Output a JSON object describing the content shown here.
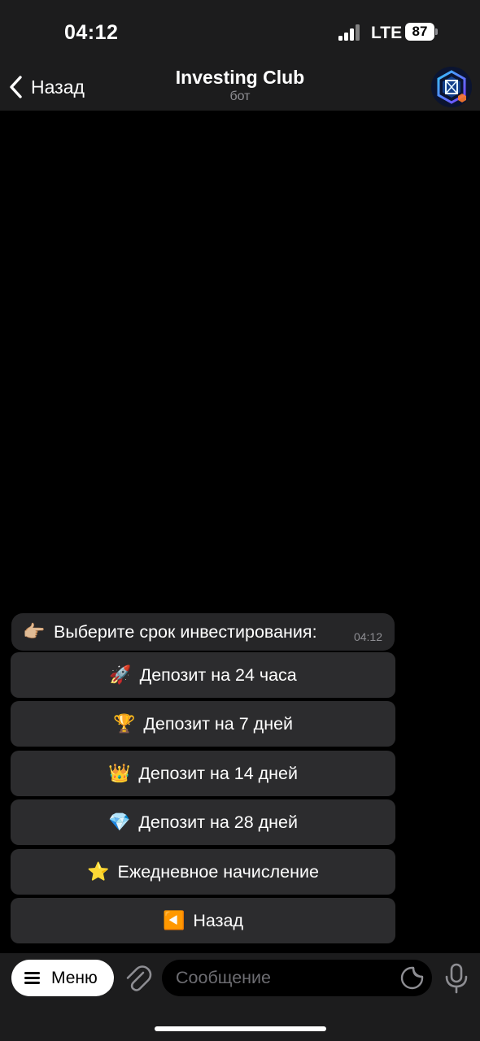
{
  "status": {
    "time": "04:12",
    "network": "LTE",
    "battery": "87"
  },
  "header": {
    "back_label": "Назад",
    "title": "Investing Club",
    "subtitle": "бот"
  },
  "message": {
    "emoji": "👉🏼",
    "text": "Выберите срок инвестирования:",
    "time": "04:12"
  },
  "keyboard": [
    {
      "emoji": "🚀",
      "label": "Депозит на 24 часа"
    },
    {
      "emoji": "🏆",
      "label": "Депозит на 7 дней"
    },
    {
      "emoji": "👑",
      "label": "Депозит на 14 дней"
    },
    {
      "emoji": "💎",
      "label": "Депозит на 28 дней"
    },
    {
      "emoji": "⭐",
      "label": "Ежедневное начисление"
    },
    {
      "emoji": "◀️",
      "label": "Назад"
    }
  ],
  "input": {
    "menu_label": "Меню",
    "placeholder": "Сообщение"
  },
  "colors": {
    "background": "#000000",
    "bar": "#1c1c1d",
    "bubble": "#262628",
    "button": "#2c2c2e",
    "muted": "#8e8e93"
  }
}
